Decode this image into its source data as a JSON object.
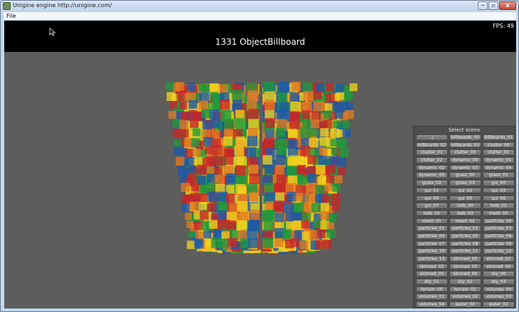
{
  "window": {
    "title": "Unigine engine http://unigine.com/",
    "minimize_glyph": "─",
    "maximize_glyph": "▫",
    "close_glyph": "x"
  },
  "menu": {
    "file_label": "File"
  },
  "viewport": {
    "fps_text": "FPS: 49",
    "scene_title": "1331 ObjectBillboard",
    "billboard_colors": [
      "#c82626",
      "#1f9a3b",
      "#f0d21e",
      "#1e5aa8",
      "#e07a22"
    ]
  },
  "scene_panel": {
    "title": "Select scene",
    "buttons": [
      "../",
      "billboards_00",
      "billboards_01",
      "billboards_02",
      "billboards_03",
      "cluster_00",
      "cluster_01",
      "clutter_00",
      "clutter_01",
      "clutter_02",
      "dynamic_00",
      "dynamic_01",
      "dynamic_02",
      "dynamic_03",
      "dynamic_04",
      "dynamic_05",
      "grass_00",
      "grass_01",
      "grass_02",
      "grass_03",
      "gui_00",
      "gui_01",
      "gui_02",
      "gui_03",
      "gui_04",
      "gui_05",
      "gui_06",
      "gui_07",
      "lods_00",
      "lods_01",
      "lods_02",
      "lods_03",
      "mesh_00",
      "mesh_01",
      "mesh_02",
      "particles_00",
      "particles_01",
      "particles_02",
      "particles_03",
      "particles_04",
      "particles_05",
      "particles_06",
      "particles_07",
      "particles_08",
      "particles_09",
      "particles_10",
      "particles_11",
      "particles_12",
      "particles_13",
      "skinned_00",
      "skinned_01",
      "skinned_02",
      "skinned_03",
      "skinned_04",
      "skinned_05",
      "skinned_06",
      "sky_00",
      "sky_01",
      "sky_02",
      "sky_03",
      "terrain_00",
      "terrain_01",
      "volumes_00",
      "volumes_01",
      "volumes_02",
      "volumes_03",
      "volumes_04",
      "water_00",
      "water_01"
    ]
  }
}
